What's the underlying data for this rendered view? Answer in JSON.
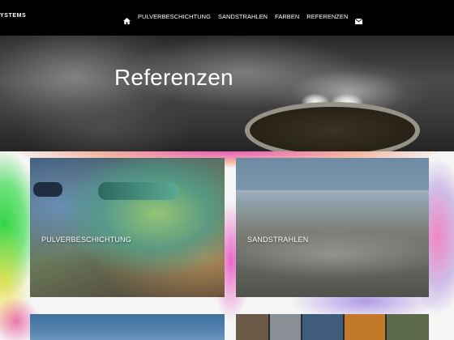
{
  "nav": {
    "brand": "YSTEMS",
    "home_icon": "home-icon",
    "items": [
      "PULVERBESCHICHTUNG",
      "SANDSTRAHLEN",
      "FARBEN",
      "REFERENZEN"
    ],
    "mail_icon": "envelope-icon"
  },
  "hero": {
    "title": "Referenzen"
  },
  "tiles": [
    {
      "label": "PULVERBESCHICHTUNG"
    },
    {
      "label": "SANDSTRAHLEN"
    }
  ],
  "colors": {
    "nav_bg": "#000000",
    "text": "#ffffff"
  }
}
